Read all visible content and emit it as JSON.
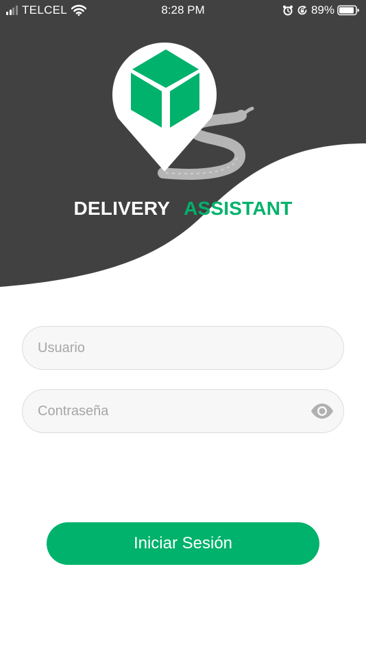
{
  "status_bar": {
    "carrier": "TELCEL",
    "time": "8:28 PM",
    "battery": "89%"
  },
  "brand": {
    "title_part1": "DELIVERY",
    "title_part2": "ASSISTANT",
    "colors": {
      "header_bg": "#414141",
      "accent": "#00b26b",
      "road": "#b5b5b5"
    }
  },
  "login_form": {
    "username_placeholder": "Usuario",
    "password_placeholder": "Contraseña",
    "submit_label": "Iniciar Sesión"
  },
  "icons": {
    "signal": "signal-bars-icon",
    "wifi": "wifi-icon",
    "alarm": "alarm-clock-icon",
    "rotation_lock": "rotation-lock-icon",
    "battery": "battery-icon",
    "logo": "map-pin-cube-icon",
    "password_visibility": "eye-icon"
  }
}
